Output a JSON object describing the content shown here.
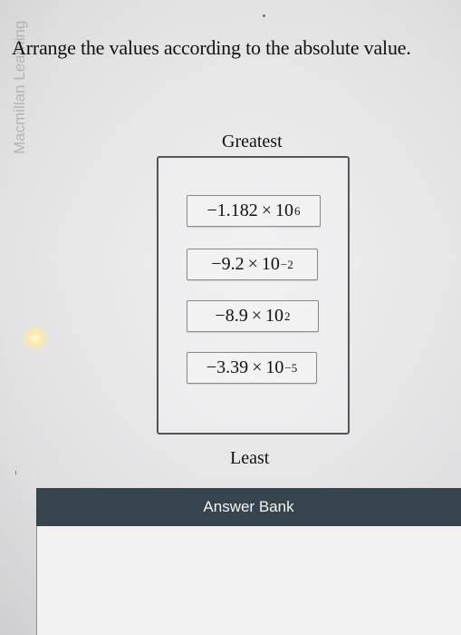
{
  "side_watermark": "Macmillan Learning",
  "question": "Arrange the values according to the absolute value.",
  "labels": {
    "greatest": "Greatest",
    "least": "Least"
  },
  "tiles": [
    {
      "mantissa": "−1.182",
      "times": "×",
      "base": "10",
      "exponent": "6"
    },
    {
      "mantissa": "−9.2",
      "times": "×",
      "base": "10",
      "exponent": "−2"
    },
    {
      "mantissa": "−8.9",
      "times": "×",
      "base": "10",
      "exponent": "2"
    },
    {
      "mantissa": "−3.39",
      "times": "×",
      "base": "10",
      "exponent": "−5"
    }
  ],
  "answer_bank": {
    "title": "Answer Bank"
  },
  "colors": {
    "answer_header_bg": "#36444d",
    "tile_bg": "#f2f2f2"
  }
}
